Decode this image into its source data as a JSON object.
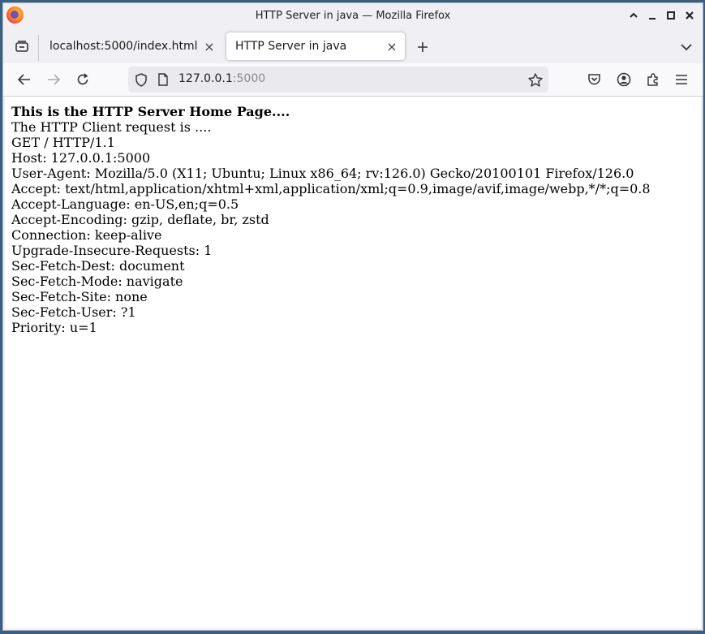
{
  "window": {
    "title": "HTTP Server in java — Mozilla Firefox",
    "controls": [
      "minimize",
      "maximize",
      "restore",
      "close"
    ]
  },
  "tabs": [
    {
      "label": "localhost:5000/index.html",
      "active": false
    },
    {
      "label": "HTTP Server in java",
      "active": true
    }
  ],
  "navbar": {
    "url_host": "127.0.0.1",
    "url_port": ":5000"
  },
  "content": {
    "heading": "This is the HTTP Server Home Page....",
    "lines": [
      "The HTTP Client request is ....",
      "GET / HTTP/1.1",
      "Host: 127.0.0.1:5000",
      "User-Agent: Mozilla/5.0 (X11; Ubuntu; Linux x86_64; rv:126.0) Gecko/20100101 Firefox/126.0",
      "Accept: text/html,application/xhtml+xml,application/xml;q=0.9,image/avif,image/webp,*/*;q=0.8",
      "Accept-Language: en-US,en;q=0.5",
      "Accept-Encoding: gzip, deflate, br, zstd",
      "Connection: keep-alive",
      "Upgrade-Insecure-Requests: 1",
      "Sec-Fetch-Dest: document",
      "Sec-Fetch-Mode: navigate",
      "Sec-Fetch-Site: none",
      "Sec-Fetch-User: ?1",
      "Priority: u=1"
    ]
  }
}
